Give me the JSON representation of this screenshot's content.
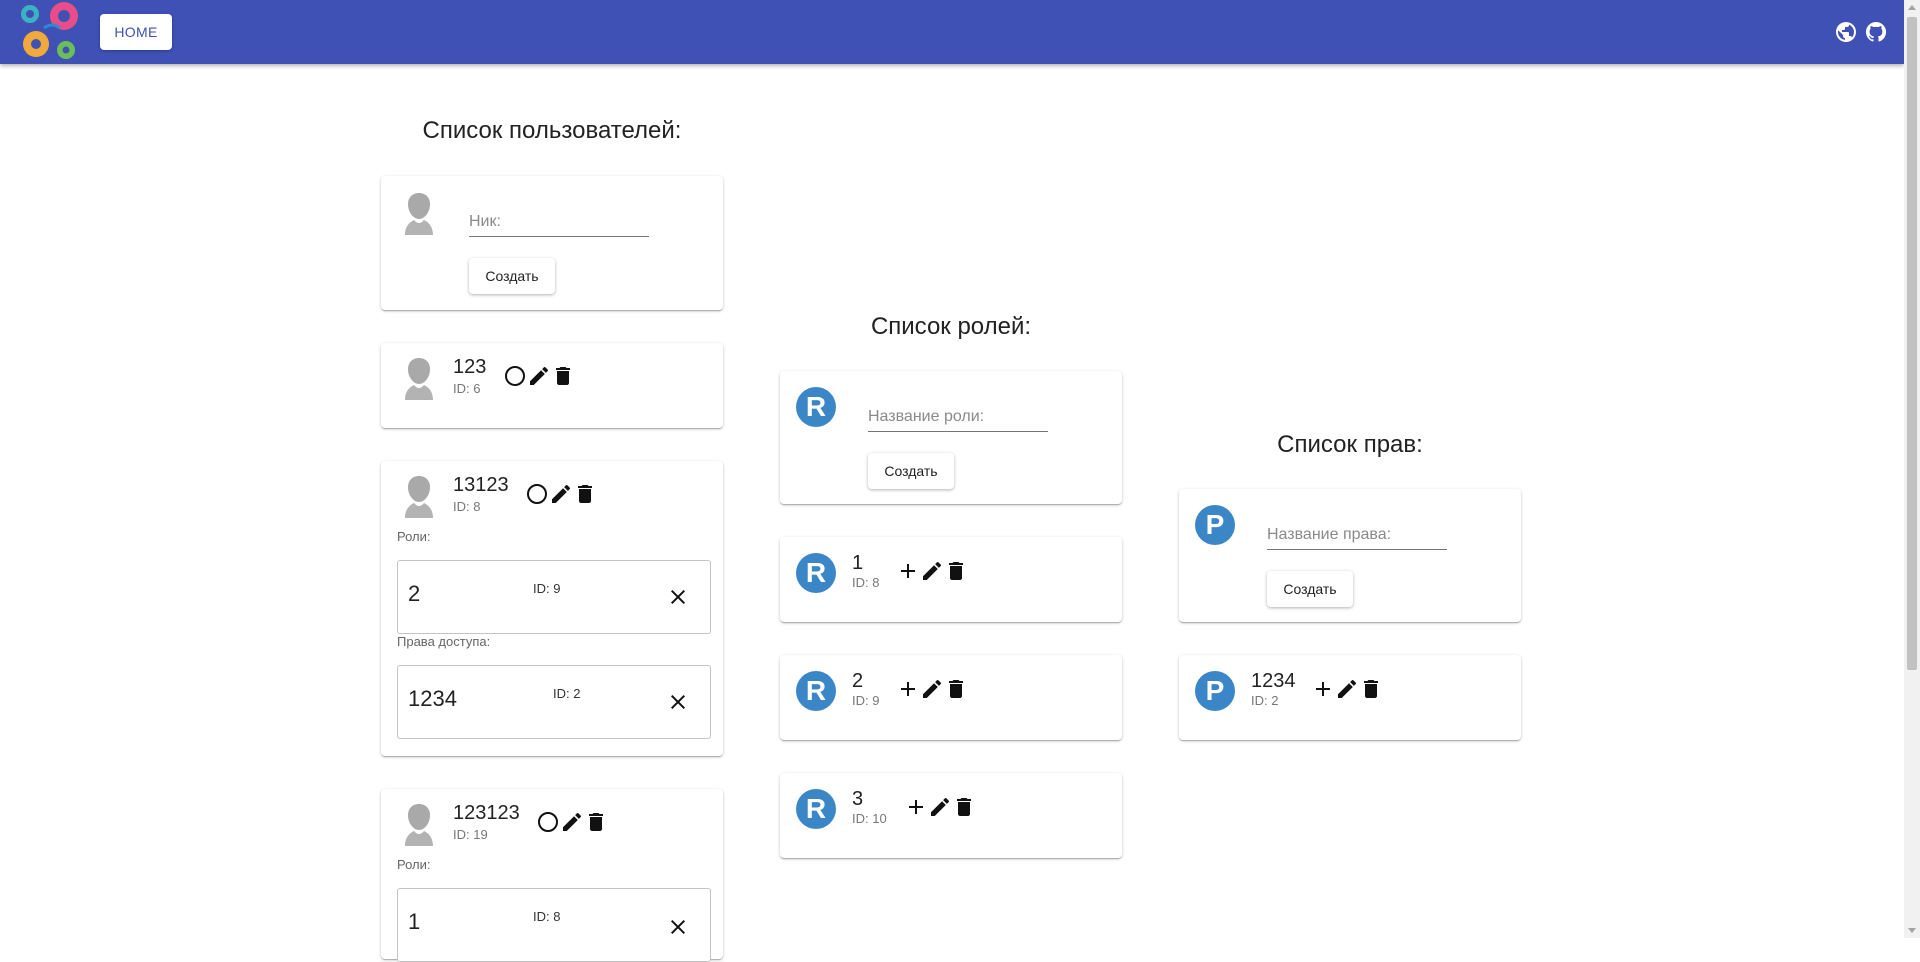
{
  "app": {
    "home_label": "HOME"
  },
  "users": {
    "title": "Список пользователей:",
    "nick_placeholder": "Ник:",
    "create_label": "Создать",
    "roles_label": "Роли:",
    "perms_label": "Права доступа:",
    "items": [
      {
        "name": "123",
        "id": "ID: 6"
      },
      {
        "name": "13123",
        "id": "ID: 8",
        "roles": [
          {
            "name": "2",
            "id": "ID: 9"
          }
        ],
        "perms": [
          {
            "name": "1234",
            "id": "ID: 2"
          }
        ]
      },
      {
        "name": "123123",
        "id": "ID: 19",
        "roles": [
          {
            "name": "1",
            "id": "ID: 8"
          }
        ]
      }
    ]
  },
  "roles": {
    "title": "Список ролей:",
    "badge": "R",
    "name_placeholder": "Название роли:",
    "create_label": "Создать",
    "items": [
      {
        "name": "1",
        "id": "ID: 8"
      },
      {
        "name": "2",
        "id": "ID: 9"
      },
      {
        "name": "3",
        "id": "ID: 10"
      }
    ]
  },
  "perms": {
    "title": "Список прав:",
    "badge": "P",
    "name_placeholder": "Название права:",
    "create_label": "Создать",
    "items": [
      {
        "name": "1234",
        "id": "ID: 2"
      }
    ]
  },
  "colors": {
    "appbar": "#3f51b5",
    "badge": "#3b86c6"
  },
  "icons": [
    "logo-gears-icon",
    "globe-icon",
    "github-icon",
    "user-avatar-icon",
    "circle-icon",
    "edit-icon",
    "delete-icon",
    "add-icon",
    "close-icon"
  ]
}
